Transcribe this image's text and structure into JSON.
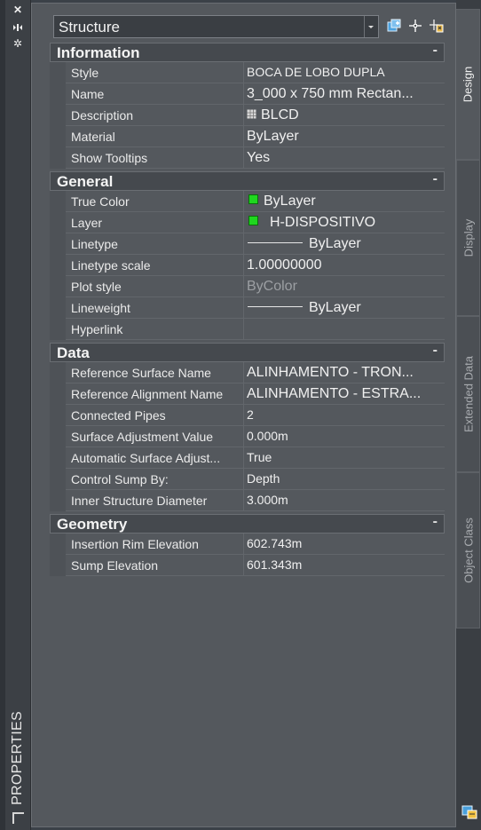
{
  "panel": {
    "title": "PROPERTIES",
    "selector_value": "Structure"
  },
  "sections": [
    {
      "title": "Information",
      "collapse": "-",
      "rows": [
        {
          "label": "Style",
          "value": "BOCA DE LOBO DUPLA"
        },
        {
          "label": "Name",
          "value": "3_000 x 750 mm Rectan..."
        },
        {
          "label": "Description",
          "value": "BLCD"
        },
        {
          "label": "Material",
          "value": "ByLayer"
        },
        {
          "label": "Show Tooltips",
          "value": "Yes"
        }
      ]
    },
    {
      "title": "General",
      "collapse": "-",
      "rows": [
        {
          "label": "True Color",
          "value": "ByLayer"
        },
        {
          "label": "Layer",
          "value": "H-DISPOSITIVO"
        },
        {
          "label": "Linetype",
          "value": "ByLayer"
        },
        {
          "label": "Linetype scale",
          "value": "1.00000000"
        },
        {
          "label": "Plot style",
          "value": "ByColor"
        },
        {
          "label": "Lineweight",
          "value": "ByLayer"
        },
        {
          "label": "Hyperlink",
          "value": ""
        }
      ]
    },
    {
      "title": "Data",
      "collapse": "-",
      "rows": [
        {
          "label": "Reference Surface Name",
          "value": "ALINHAMENTO  -  TRON..."
        },
        {
          "label": "Reference Alignment Name",
          "value": "ALINHAMENTO  -  ESTRA..."
        },
        {
          "label": "Connected Pipes",
          "value": "2"
        },
        {
          "label": "Surface Adjustment Value",
          "value": "0.000m"
        },
        {
          "label": "Automatic Surface Adjust...",
          "value": "True"
        },
        {
          "label": "Control Sump By:",
          "value": "Depth"
        },
        {
          "label": "Inner Structure Diameter",
          "value": "3.000m"
        }
      ]
    },
    {
      "title": "Geometry",
      "collapse": "-",
      "rows": [
        {
          "label": "Insertion Rim Elevation",
          "value": "602.743m"
        },
        {
          "label": "Sump Elevation",
          "value": "601.343m"
        }
      ]
    }
  ],
  "tabs": [
    "Design",
    "Display",
    "Extended Data",
    "Object Class"
  ],
  "colors": {
    "layer_swatch": "#1fd71f"
  }
}
